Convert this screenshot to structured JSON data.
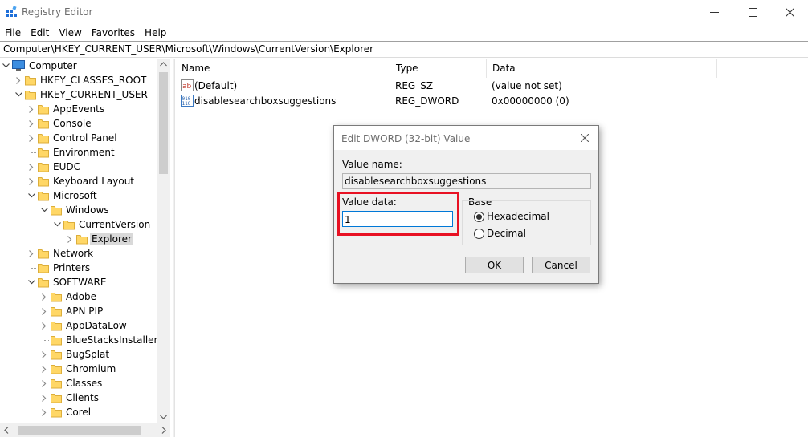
{
  "window": {
    "title": "Registry Editor"
  },
  "menu": [
    "File",
    "Edit",
    "View",
    "Favorites",
    "Help"
  ],
  "address": "Computer\\HKEY_CURRENT_USER\\Microsoft\\Windows\\CurrentVersion\\Explorer",
  "tree": [
    {
      "label": "Computer",
      "depth": 0,
      "expander": "open",
      "icon": "computer-icon"
    },
    {
      "label": "HKEY_CLASSES_ROOT",
      "depth": 1,
      "expander": "closed",
      "icon": "folder-icon"
    },
    {
      "label": "HKEY_CURRENT_USER",
      "depth": 1,
      "expander": "open",
      "icon": "folder-icon"
    },
    {
      "label": "AppEvents",
      "depth": 2,
      "expander": "closed",
      "icon": "folder-icon"
    },
    {
      "label": "Console",
      "depth": 2,
      "expander": "closed",
      "icon": "folder-icon"
    },
    {
      "label": "Control Panel",
      "depth": 2,
      "expander": "closed",
      "icon": "folder-icon"
    },
    {
      "label": "Environment",
      "depth": 2,
      "expander": "none",
      "icon": "folder-icon"
    },
    {
      "label": "EUDC",
      "depth": 2,
      "expander": "closed",
      "icon": "folder-icon"
    },
    {
      "label": "Keyboard Layout",
      "depth": 2,
      "expander": "closed",
      "icon": "folder-icon"
    },
    {
      "label": "Microsoft",
      "depth": 2,
      "expander": "open",
      "icon": "folder-icon"
    },
    {
      "label": "Windows",
      "depth": 3,
      "expander": "open",
      "icon": "folder-icon"
    },
    {
      "label": "CurrentVersion",
      "depth": 4,
      "expander": "open",
      "icon": "folder-icon"
    },
    {
      "label": "Explorer",
      "depth": 5,
      "expander": "closed",
      "icon": "folder-icon",
      "selected": true
    },
    {
      "label": "Network",
      "depth": 2,
      "expander": "closed",
      "icon": "folder-icon"
    },
    {
      "label": "Printers",
      "depth": 2,
      "expander": "none",
      "icon": "folder-icon"
    },
    {
      "label": "SOFTWARE",
      "depth": 2,
      "expander": "open",
      "icon": "folder-icon"
    },
    {
      "label": "Adobe",
      "depth": 3,
      "expander": "closed",
      "icon": "folder-icon"
    },
    {
      "label": "APN PIP",
      "depth": 3,
      "expander": "closed",
      "icon": "folder-icon"
    },
    {
      "label": "AppDataLow",
      "depth": 3,
      "expander": "closed",
      "icon": "folder-icon"
    },
    {
      "label": "BlueStacksInstaller",
      "depth": 3,
      "expander": "none",
      "icon": "folder-icon"
    },
    {
      "label": "BugSplat",
      "depth": 3,
      "expander": "closed",
      "icon": "folder-icon"
    },
    {
      "label": "Chromium",
      "depth": 3,
      "expander": "closed",
      "icon": "folder-icon"
    },
    {
      "label": "Classes",
      "depth": 3,
      "expander": "closed",
      "icon": "folder-icon"
    },
    {
      "label": "Clients",
      "depth": 3,
      "expander": "closed",
      "icon": "folder-icon"
    },
    {
      "label": "Corel",
      "depth": 3,
      "expander": "closed",
      "icon": "folder-icon"
    }
  ],
  "list": {
    "columns": [
      "Name",
      "Type",
      "Data"
    ],
    "rows": [
      {
        "icon": "string-value-icon",
        "name": "(Default)",
        "type": "REG_SZ",
        "data": "(value not set)"
      },
      {
        "icon": "binary-value-icon",
        "name": "disablesearchboxsuggestions",
        "type": "REG_DWORD",
        "data": "0x00000000 (0)"
      }
    ]
  },
  "dialog": {
    "title": "Edit DWORD (32-bit) Value",
    "value_name_label": "Value name:",
    "value_name": "disablesearchboxsuggestions",
    "value_data_label": "Value data:",
    "value_data": "1",
    "base_label": "Base",
    "hex_label": "Hexadecimal",
    "dec_label": "Decimal",
    "selected_base": "Hexadecimal",
    "ok_label": "OK",
    "cancel_label": "Cancel",
    "highlight_color": "#e81123"
  }
}
